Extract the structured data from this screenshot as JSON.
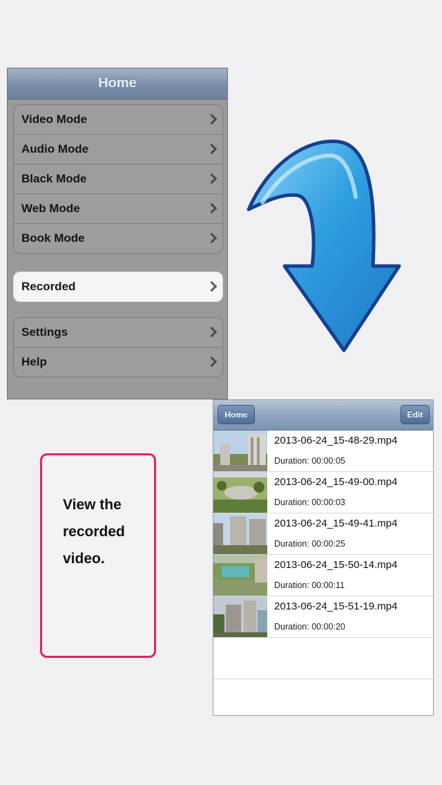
{
  "home": {
    "title": "Home",
    "modes": [
      {
        "label": "Video Mode"
      },
      {
        "label": "Audio Mode"
      },
      {
        "label": "Black Mode"
      },
      {
        "label": "Web Mode"
      },
      {
        "label": "Book Mode"
      }
    ],
    "recorded": {
      "label": "Recorded"
    },
    "extra": [
      {
        "label": "Settings"
      },
      {
        "label": "Help"
      }
    ]
  },
  "note": {
    "lines": [
      "View the",
      "recorded",
      "video."
    ],
    "border_color": "#e0245e"
  },
  "recorded_list": {
    "back_label": "Home",
    "edit_label": "Edit",
    "videos": [
      {
        "name": "2013-06-24_15-48-29.mp4",
        "duration": "Duration: 00:00:05"
      },
      {
        "name": "2013-06-24_15-49-00.mp4",
        "duration": "Duration: 00:00:03"
      },
      {
        "name": "2013-06-24_15-49-41.mp4",
        "duration": "Duration: 00:00:25"
      },
      {
        "name": "2013-06-24_15-50-14.mp4",
        "duration": "Duration: 00:00:11"
      },
      {
        "name": "2013-06-24_15-51-19.mp4",
        "duration": "Duration: 00:00:20"
      }
    ]
  },
  "colors": {
    "arrow_fill": "#2f9fe0",
    "arrow_outline": "#163f8f"
  }
}
